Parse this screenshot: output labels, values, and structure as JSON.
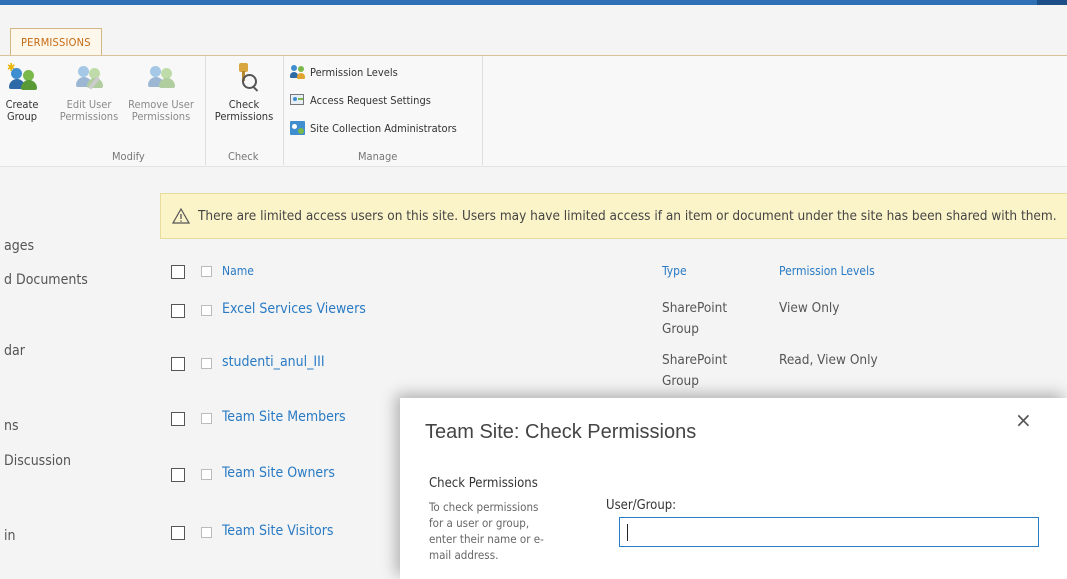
{
  "ribbon": {
    "tab_label": "PERMISSIONS",
    "buttons": {
      "create_group": "Create\nGroup",
      "edit_user": "Edit User\nPermissions",
      "remove_user": "Remove User\nPermissions",
      "check": "Check\nPermissions"
    },
    "groups": {
      "modify": "Modify",
      "check": "Check",
      "manage": "Manage"
    },
    "manage_items": [
      "Permission Levels",
      "Access Request Settings",
      "Site Collection Administrators"
    ]
  },
  "nav": [
    "ages",
    "d Documents",
    "dar",
    "ns",
    "Discussion",
    "in"
  ],
  "banner_text": "There are limited access users on this site. Users may have limited access if an item or document under the site has been shared with them.",
  "table": {
    "headers": {
      "name": "Name",
      "type": "Type",
      "perm": "Permission Levels"
    },
    "rows": [
      {
        "name": "Excel Services Viewers",
        "type": "SharePoint Group",
        "perm": "View Only"
      },
      {
        "name": "studenti_anul_III",
        "type": "SharePoint Group",
        "perm": "Read, View Only"
      },
      {
        "name": "Team Site Members",
        "type": "",
        "perm": ""
      },
      {
        "name": "Team Site Owners",
        "type": "",
        "perm": ""
      },
      {
        "name": "Team Site Visitors",
        "type": "",
        "perm": ""
      }
    ]
  },
  "dialog": {
    "title": "Team Site: Check Permissions",
    "close": "×",
    "section_title": "Check Permissions",
    "description": "To check permissions for a user or group, enter their name or e-mail address.",
    "field_label": "User/Group:",
    "field_value": ""
  },
  "colors": {
    "accent": "#2a7bc4",
    "tab": "#c76a12",
    "banner_bg": "#fbf4c8",
    "topbar": "#2f6fb3"
  }
}
